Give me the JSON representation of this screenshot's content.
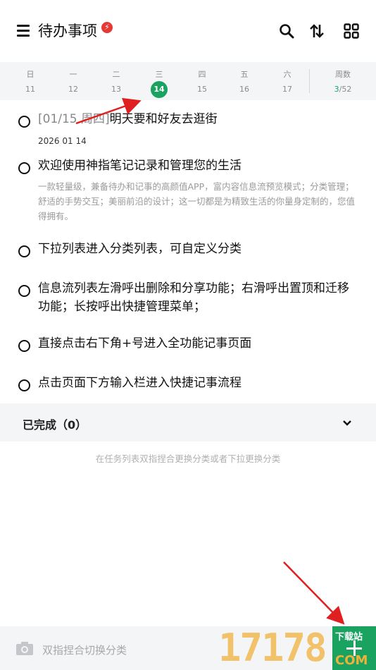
{
  "header": {
    "title": "待办事项",
    "badge": "⚡",
    "icons": [
      "menu-icon",
      "search-icon",
      "sort-icon",
      "grid-icon"
    ]
  },
  "calendar": {
    "days": [
      {
        "weekday": "日",
        "date": "11"
      },
      {
        "weekday": "一",
        "date": "12"
      },
      {
        "weekday": "二",
        "date": "13"
      },
      {
        "weekday": "三",
        "date": "14"
      },
      {
        "weekday": "四",
        "date": "15"
      },
      {
        "weekday": "五",
        "date": "16"
      },
      {
        "weekday": "六",
        "date": "17"
      }
    ],
    "week_label": "周数",
    "week_current": "3",
    "week_total": "/52",
    "accent": "#1aa260"
  },
  "tasks": [
    {
      "prefix": "[01/15 周四]",
      "text": "明天要和好友去逛街",
      "date": "2026 01 14"
    },
    {
      "text": "欢迎使用神指笔记记录和管理您的生活",
      "desc": "一款轻量级，兼备待办和记事的高颜值APP，富内容信息流预览模式；分类管理；舒适的手势交互；美丽前沿的设计；这一切都是为精致生活的你量身定制的，您值得拥有。"
    },
    {
      "text": "下拉列表进入分类列表，可自定义分类"
    },
    {
      "text": "信息流列表左滑呼出删除和分享功能；右滑呼出置顶和迁移功能；长按呼出快捷管理菜单；"
    },
    {
      "text": "直接点击右下角+号进入全功能记事页面"
    },
    {
      "text": "点击页面下方输入栏进入快捷记事流程"
    }
  ],
  "completed": {
    "label": "已完成（0）"
  },
  "hint": "在任务列表双指捏合更换分类或者下拉更换分类",
  "bottom": {
    "placeholder": "双指捏合切换分类"
  },
  "watermark": {
    "digits": "17178",
    "top": "下载站",
    "bottom": "COM"
  }
}
